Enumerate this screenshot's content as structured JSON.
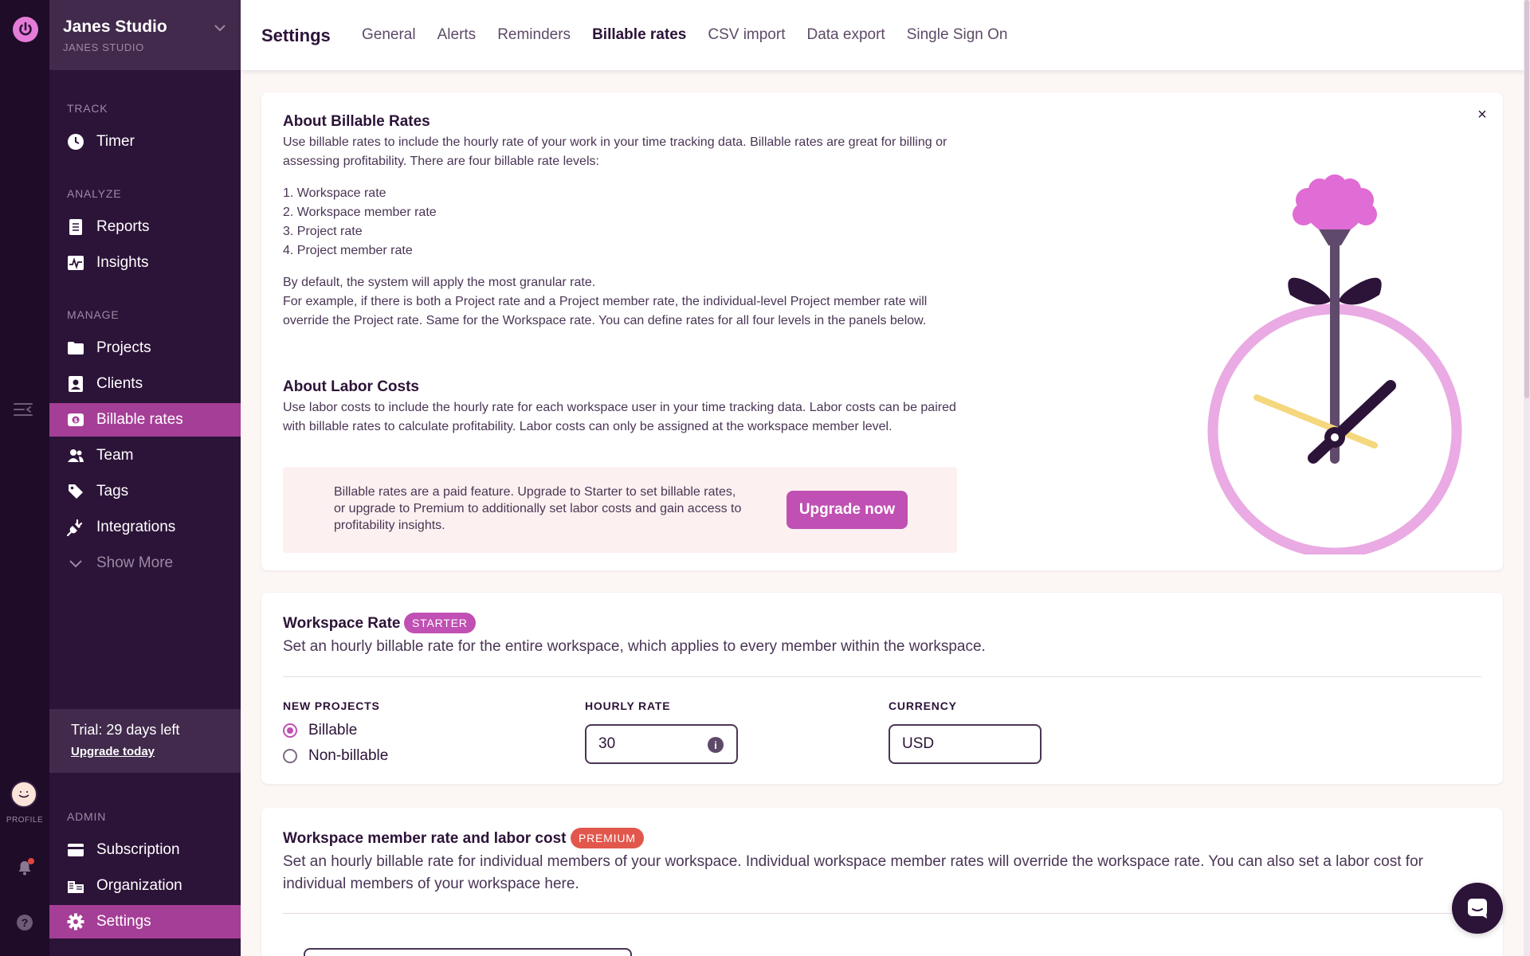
{
  "workspace": {
    "name": "Janes Studio",
    "sub": "JANES STUDIO"
  },
  "sidebar": {
    "track_label": "TRACK",
    "analyze_label": "ANALYZE",
    "manage_label": "MANAGE",
    "admin_label": "ADMIN",
    "items": {
      "timer": "Timer",
      "reports": "Reports",
      "insights": "Insights",
      "projects": "Projects",
      "clients": "Clients",
      "billable_rates": "Billable rates",
      "team": "Team",
      "tags": "Tags",
      "integrations": "Integrations",
      "show_more": "Show More",
      "subscription": "Subscription",
      "organization": "Organization",
      "settings": "Settings"
    },
    "trial": {
      "text": "Trial: 29 days left",
      "link": "Upgrade today"
    }
  },
  "rail": {
    "profile_label": "PROFILE",
    "help": "?"
  },
  "header": {
    "title": "Settings",
    "tabs": [
      "General",
      "Alerts",
      "Reminders",
      "Billable rates",
      "CSV import",
      "Data export",
      "Single Sign On"
    ],
    "active_tab": "Billable rates"
  },
  "about": {
    "title": "About Billable Rates",
    "intro": "Use billable rates to include the hourly rate of your work in your time tracking data. Billable rates are great for billing or assessing profitability. There are four billable rate levels:",
    "levels": [
      "1. Workspace rate",
      "2. Workspace member rate",
      "3. Project rate",
      "4. Project member rate"
    ],
    "default_line": "By default, the system will apply the most granular rate.",
    "example": "For example, if there is both a Project rate and a Project member rate, the individual-level Project member rate will override the Project rate. Same for the Workspace rate. You can define rates for all four levels in the panels below.",
    "labor_title": "About Labor Costs",
    "labor_text": "Use labor costs to include the hourly rate for each workspace user in your time tracking data. Labor costs can be paired with billable rates to calculate profitability. Labor costs can only be assigned at the workspace member level.",
    "upsell_text": "Billable rates are a paid feature. Upgrade to Starter to set billable rates, or upgrade to Premium to additionally set labor costs and gain access to profitability insights.",
    "upsell_button": "Upgrade now",
    "close": "×"
  },
  "workspace_rate": {
    "title": "Workspace Rate",
    "badge": "STARTER",
    "description": "Set an hourly billable rate for the entire workspace, which applies to every member within the workspace.",
    "new_projects_label": "NEW PROJECTS",
    "option_billable": "Billable",
    "option_nonbillable": "Non-billable",
    "selected": "Billable",
    "hourly_rate_label": "HOURLY RATE",
    "hourly_rate_value": "30",
    "currency_label": "CURRENCY",
    "currency_value": "USD",
    "info_icon": "i"
  },
  "member_rate": {
    "title": "Workspace member rate and labor cost",
    "badge": "PREMIUM",
    "description": "Set an hourly billable rate for individual members of your workspace. Individual workspace member rates will override the workspace rate. You can also set a labor cost for individual members of your workspace here."
  },
  "colors": {
    "accent": "#c050b3",
    "sidebar_bg": "#2c1338",
    "rail_bg": "#1e0c28",
    "premium": "#e2574c"
  }
}
